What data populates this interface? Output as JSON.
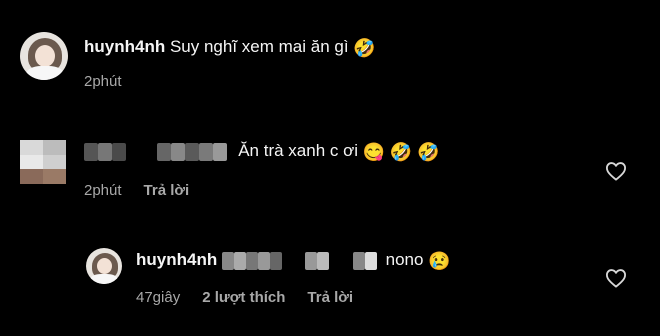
{
  "comments": [
    {
      "username": "huynh4nh",
      "text": "Suy nghĩ xem mai ăn gì",
      "emojis": [
        "🤣"
      ],
      "time": "2phút"
    },
    {
      "username": "",
      "text": "Ăn trà xanh c ơi",
      "emojis": [
        "😋",
        "🤣",
        "🤣"
      ],
      "time": "2phút",
      "reply_label": "Trả lời"
    }
  ],
  "reply": {
    "username": "huynh4nh",
    "text": "nono",
    "emojis": [
      "😢"
    ],
    "time": "47giây",
    "likes": "2 lượt thích",
    "reply_label": "Trả lời"
  },
  "icons": {
    "like": "heart-outline-icon"
  },
  "colors": {
    "background": "#000000",
    "text": "#f5f5f5",
    "meta": "#a8a8a8"
  }
}
